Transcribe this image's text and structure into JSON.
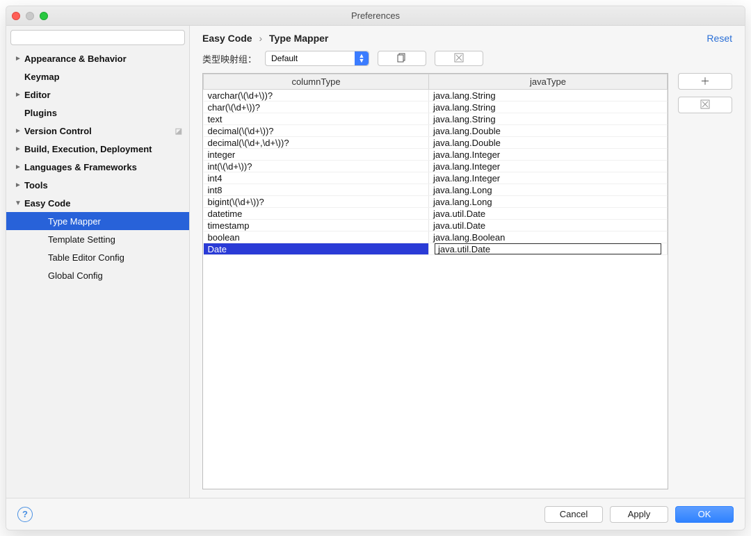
{
  "window": {
    "title": "Preferences"
  },
  "search": {
    "placeholder": ""
  },
  "sidebar": {
    "items": [
      {
        "label": "Appearance & Behavior",
        "arrow": "►",
        "bold": true
      },
      {
        "label": "Keymap",
        "arrow": "",
        "bold": true
      },
      {
        "label": "Editor",
        "arrow": "►",
        "bold": true
      },
      {
        "label": "Plugins",
        "arrow": "",
        "bold": true
      },
      {
        "label": "Version Control",
        "arrow": "►",
        "bold": true,
        "vcs": true
      },
      {
        "label": "Build, Execution, Deployment",
        "arrow": "►",
        "bold": true
      },
      {
        "label": "Languages & Frameworks",
        "arrow": "►",
        "bold": true
      },
      {
        "label": "Tools",
        "arrow": "►",
        "bold": true
      },
      {
        "label": "Easy Code",
        "arrow": "▼",
        "bold": true
      },
      {
        "label": "Type Mapper",
        "child": true,
        "selected": true
      },
      {
        "label": "Template Setting",
        "child": true
      },
      {
        "label": "Table Editor Config",
        "child": true
      },
      {
        "label": "Global Config",
        "child": true
      }
    ]
  },
  "breadcrumb": {
    "root": "Easy Code",
    "page": "Type Mapper"
  },
  "reset_label": "Reset",
  "toolbar": {
    "group_label": "类型映射组：",
    "group_selected": "Default"
  },
  "table": {
    "headers": {
      "col1": "columnType",
      "col2": "javaType"
    },
    "rows": [
      {
        "c": "varchar(\\(\\d+\\))?",
        "j": "java.lang.String"
      },
      {
        "c": "char(\\(\\d+\\))?",
        "j": "java.lang.String"
      },
      {
        "c": "text",
        "j": "java.lang.String"
      },
      {
        "c": "decimal(\\(\\d+\\))?",
        "j": "java.lang.Double"
      },
      {
        "c": "decimal(\\(\\d+,\\d+\\))?",
        "j": "java.lang.Double"
      },
      {
        "c": "integer",
        "j": "java.lang.Integer"
      },
      {
        "c": "int(\\(\\d+\\))?",
        "j": "java.lang.Integer"
      },
      {
        "c": "int4",
        "j": "java.lang.Integer"
      },
      {
        "c": "int8",
        "j": "java.lang.Long"
      },
      {
        "c": "bigint(\\(\\d+\\))?",
        "j": "java.lang.Long"
      },
      {
        "c": "datetime",
        "j": "java.util.Date"
      },
      {
        "c": "timestamp",
        "j": "java.util.Date"
      },
      {
        "c": "boolean",
        "j": "java.lang.Boolean"
      },
      {
        "c": "Date",
        "j": "java.util.Date",
        "selected": true,
        "editing": true
      }
    ]
  },
  "footer": {
    "cancel": "Cancel",
    "apply": "Apply",
    "ok": "OK"
  }
}
